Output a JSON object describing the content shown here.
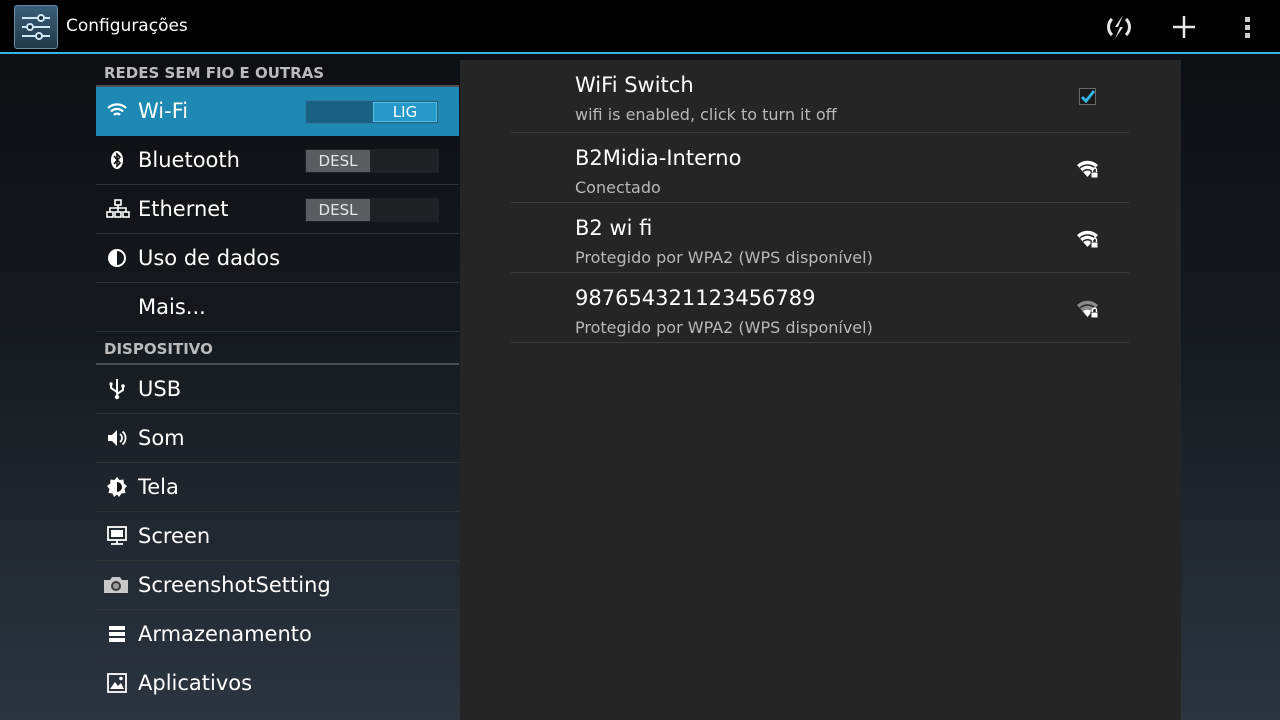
{
  "actionbar": {
    "title": "Configurações",
    "icons": [
      "settings-app-icon",
      "refresh-icon",
      "add-icon",
      "overflow-menu-icon"
    ]
  },
  "sidebar": {
    "sections": [
      {
        "header": "REDES SEM FIO E OUTRAS",
        "items": [
          {
            "label": "Wi-Fi",
            "icon": "wifi-icon",
            "toggle": "LIG",
            "selected": true
          },
          {
            "label": "Bluetooth",
            "icon": "bluetooth-icon",
            "toggle": "DESL"
          },
          {
            "label": "Ethernet",
            "icon": "ethernet-icon",
            "toggle": "DESL"
          },
          {
            "label": "Uso de dados",
            "icon": "data-usage-icon"
          },
          {
            "label": "Mais..."
          }
        ]
      },
      {
        "header": "DISPOSITIVO",
        "items": [
          {
            "label": "USB",
            "icon": "usb-icon"
          },
          {
            "label": "Som",
            "icon": "sound-icon"
          },
          {
            "label": "Tela",
            "icon": "display-icon"
          },
          {
            "label": "Screen",
            "icon": "screen-icon"
          },
          {
            "label": "ScreenshotSetting",
            "icon": "camera-icon"
          },
          {
            "label": "Armazenamento",
            "icon": "storage-icon"
          },
          {
            "label": "Aplicativos",
            "icon": "apps-icon"
          }
        ]
      }
    ]
  },
  "wifi_panel": {
    "switch": {
      "title": "WiFi Switch",
      "summary": "wifi is enabled, click to turn it off",
      "checked": true
    },
    "networks": [
      {
        "ssid": "B2Midia-Interno",
        "status": "Conectado",
        "icon": "wifi-lock-icon"
      },
      {
        "ssid": "B2 wi fi",
        "status": "Protegido por WPA2 (WPS disponível)",
        "icon": "wifi-lock-icon"
      },
      {
        "ssid": "987654321123456789",
        "status": "Protegido por WPA2 (WPS disponível)",
        "icon": "wifi-lock-weak-icon"
      }
    ]
  },
  "colors": {
    "accent": "#33b5e5",
    "selected_row": "#1e89b2",
    "panel_bg": "#252525"
  }
}
